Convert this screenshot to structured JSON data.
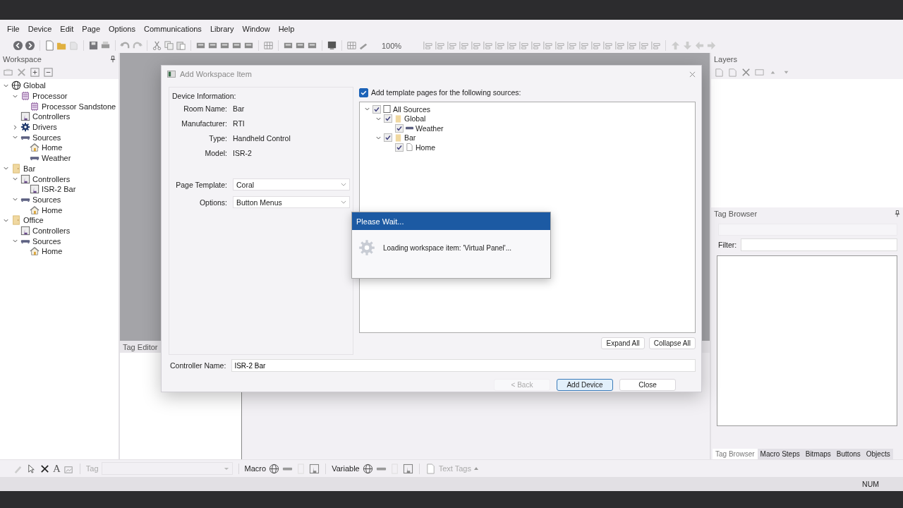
{
  "menu": [
    "File",
    "Device",
    "Edit",
    "Page",
    "Options",
    "Communications",
    "Library",
    "Window",
    "Help"
  ],
  "toolbar": {
    "zoom": "100%"
  },
  "workspace": {
    "title": "Workspace",
    "tree": [
      {
        "label": "Global",
        "kind": "globe",
        "expanded": true,
        "children": [
          {
            "label": "Processor",
            "kind": "processor",
            "expanded": true,
            "children": [
              {
                "label": "Processor Sandstone",
                "kind": "processor"
              }
            ]
          },
          {
            "label": "Controllers",
            "kind": "controller"
          },
          {
            "label": "Drivers",
            "kind": "driver",
            "expanded": false
          },
          {
            "label": "Sources",
            "kind": "source",
            "expanded": true,
            "children": [
              {
                "label": "Home",
                "kind": "house"
              },
              {
                "label": "Weather",
                "kind": "source"
              }
            ]
          }
        ]
      },
      {
        "label": "Bar",
        "kind": "room",
        "expanded": true,
        "children": [
          {
            "label": "Controllers",
            "kind": "controller",
            "expanded": true,
            "children": [
              {
                "label": "ISR-2 Bar",
                "kind": "controller"
              }
            ]
          },
          {
            "label": "Sources",
            "kind": "source",
            "expanded": true,
            "children": [
              {
                "label": "Home",
                "kind": "house"
              }
            ]
          }
        ]
      },
      {
        "label": "Office",
        "kind": "room",
        "expanded": true,
        "children": [
          {
            "label": "Controllers",
            "kind": "controller"
          },
          {
            "label": "Sources",
            "kind": "source",
            "expanded": true,
            "children": [
              {
                "label": "Home",
                "kind": "house"
              }
            ]
          }
        ]
      }
    ]
  },
  "tag_editor": {
    "title": "Tag Editor"
  },
  "layers": {
    "title": "Layers"
  },
  "tag_browser": {
    "title": "Tag Browser",
    "filter_label": "Filter:"
  },
  "right_tabs": [
    {
      "label": "Tag Browser",
      "selected": true
    },
    {
      "label": "Macro Steps",
      "selected": false
    },
    {
      "label": "Bitmaps",
      "selected": false
    },
    {
      "label": "Buttons",
      "selected": false
    },
    {
      "label": "Objects",
      "selected": false
    }
  ],
  "bottom_toolbar": {
    "text_glyph": "A",
    "tag_label": "Tag",
    "macro_label": "Macro",
    "variable_label": "Variable",
    "text_tags": "Text Tags"
  },
  "status_bar": {
    "num": "NUM"
  },
  "dialog": {
    "title": "Add Workspace Item",
    "section": "Device Information:",
    "fields": [
      {
        "label": "Room Name:",
        "value": "Bar"
      },
      {
        "label": "Manufacturer:",
        "value": "RTI"
      },
      {
        "label": "Type:",
        "value": "Handheld Control"
      },
      {
        "label": "Model:",
        "value": "ISR-2"
      }
    ],
    "selects": [
      {
        "label": "Page Template:",
        "value": "Coral"
      },
      {
        "label": "Options:",
        "value": "Button Menus"
      }
    ],
    "template_checkbox": {
      "label": "Add template pages for the following sources:",
      "checked": true
    },
    "sources_tree": [
      {
        "label": "All Sources",
        "kind": "all",
        "checked": true,
        "expanded": true,
        "children": [
          {
            "label": "Global",
            "kind": "room",
            "checked": true,
            "expanded": true,
            "children": [
              {
                "label": "Weather",
                "kind": "source",
                "checked": true
              }
            ]
          },
          {
            "label": "Bar",
            "kind": "room",
            "checked": true,
            "expanded": true,
            "children": [
              {
                "label": "Home",
                "kind": "page",
                "checked": true
              }
            ]
          }
        ]
      }
    ],
    "expand_all": "Expand All",
    "collapse_all": "Collapse All",
    "controller_name": {
      "label": "Controller Name:",
      "value": "ISR-2 Bar"
    },
    "buttons": [
      {
        "label": "< Back",
        "disabled": true,
        "default": false
      },
      {
        "label": "Add Device",
        "disabled": false,
        "default": true
      },
      {
        "label": "Close",
        "disabled": false,
        "default": false
      }
    ]
  },
  "wait": {
    "title": "Please Wait...",
    "message": "Loading workspace item: 'Virtual Panel'..."
  }
}
